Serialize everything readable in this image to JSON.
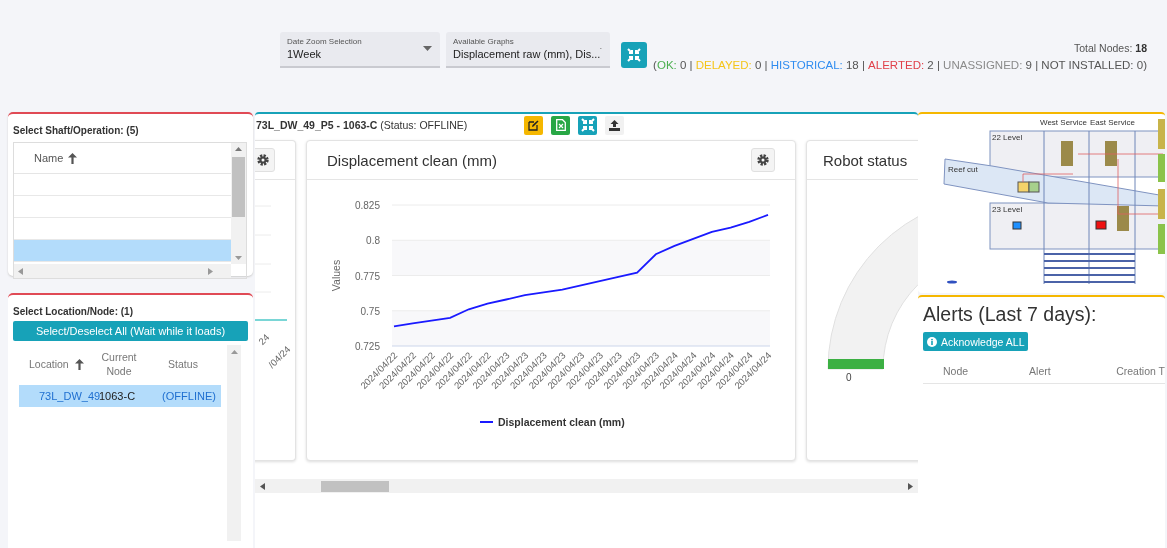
{
  "header": {
    "dropdowns": [
      {
        "label": "Date Zoom Selection",
        "value": "1Week"
      },
      {
        "label": "Available Graphs",
        "value": "Displacement raw (mm), Dis..."
      }
    ],
    "total_nodes": {
      "label": "Total Nodes:",
      "value": "18"
    },
    "summary": {
      "open": "(",
      "close": ")",
      "separator": "|",
      "items": [
        {
          "label": "OK:",
          "value": "0",
          "color": "#4caf50"
        },
        {
          "label": "DELAYED:",
          "value": "0",
          "color": "#f5c518"
        },
        {
          "label": "HISTORICAL:",
          "value": "18",
          "color": "#2f8cf0"
        },
        {
          "label": "ALERTED:",
          "value": "2",
          "color": "#e0404a"
        },
        {
          "label": "UNASSIGNED:",
          "value": "9",
          "color": "#8a8a8a"
        },
        {
          "label": "NOT INSTALLED:",
          "value": "0",
          "color": "#555555"
        }
      ]
    }
  },
  "shaft_panel": {
    "title": "Select Shaft/Operation: (5)",
    "columns": [
      {
        "label": "Name",
        "sorted": true
      }
    ],
    "rows": [
      {
        "selected": false
      },
      {
        "selected": false
      },
      {
        "selected": false
      },
      {
        "selected": true
      }
    ]
  },
  "node_panel": {
    "title": "Select Location/Node: (1)",
    "select_all": "Select/Deselect All (Wait while it loads)",
    "columns": [
      {
        "label": "Location",
        "sorted": true
      },
      {
        "label": "Current Node",
        "sorted": false
      },
      {
        "label": "Status",
        "sorted": false
      }
    ],
    "rows": [
      {
        "cells": [
          "73L_DW_49",
          "1063-C",
          "(OFFLINE)"
        ],
        "selected": true
      }
    ]
  },
  "node_view": {
    "title": "**73L_DW_49_P5 - 1063-C** (Status: OFFLINE)",
    "actions": [
      {
        "kind": "edit"
      },
      {
        "kind": "excel"
      },
      {
        "kind": "compress"
      },
      {
        "kind": "upload"
      }
    ],
    "cards": [
      {
        "kind": "partial",
        "axis_labels": [
          "24",
          "/04/24"
        ]
      },
      {
        "kind": "chart",
        "title": "Displacement clean (mm)",
        "chart_data": {
          "type": "line",
          "ylabel": "Values",
          "categories": [
            "2024/04/22",
            "2024/04/22",
            "2024/04/22",
            "2024/04/22",
            "2024/04/22",
            "2024/04/22",
            "2024/04/23",
            "2024/04/23",
            "2024/04/23",
            "2024/04/23",
            "2024/04/23",
            "2024/04/23",
            "2024/04/23",
            "2024/04/23",
            "2024/04/23",
            "2024/04/24",
            "2024/04/24",
            "2024/04/24",
            "2024/04/24",
            "2024/04/24",
            "2024/04/24"
          ],
          "series": [
            {
              "name": "Displacement clean (mm)",
              "color": "#1a1aff",
              "values": [
                0.739,
                0.741,
                0.743,
                0.745,
                0.751,
                0.755,
                0.758,
                0.761,
                0.763,
                0.765,
                0.768,
                0.771,
                0.774,
                0.777,
                0.79,
                0.796,
                0.801,
                0.806,
                0.809,
                0.813,
                0.818
              ]
            }
          ],
          "grid": true,
          "ylim": [
            0.725,
            0.825
          ],
          "yticks": [
            0.725,
            0.75,
            0.775,
            0.8,
            0.825
          ]
        }
      },
      {
        "kind": "gauge",
        "title": "Robot status",
        "reading": "0"
      }
    ]
  },
  "diagram": {
    "labels": [
      "West Service",
      "East Service",
      "22 Level",
      "Reef cut",
      "23 Level"
    ]
  },
  "alerts": {
    "title": "Alerts (Last 7 days):",
    "acknowledge": "Acknowledge ALL",
    "columns": [
      "Node",
      "Alert",
      "Creation T"
    ]
  }
}
